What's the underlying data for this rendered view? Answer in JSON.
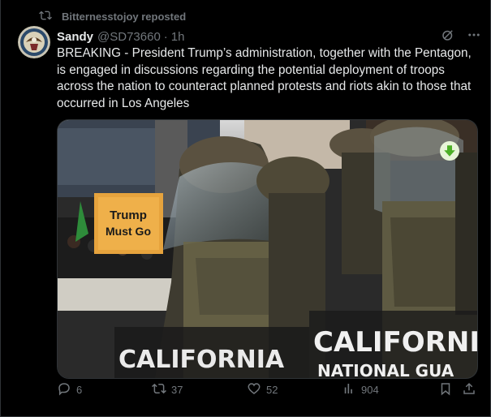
{
  "repost": {
    "text": "Bitternesstojoy reposted",
    "icon": "repost-icon"
  },
  "author": {
    "name": "Sandy",
    "handle": "@SD73660",
    "separator": "·",
    "time": "1h",
    "avatar": "eagle-seal-avatar"
  },
  "post_text": "BREAKING - President Trump’s administration, together with the Pentagon, is engaged in discussions regarding the potential deployment of troops across the nation to counteract planned protests and riots akin to those that occurred in Los Angeles",
  "media": {
    "sign_lines": [
      "Trump",
      "Must Go"
    ],
    "shield_text_left": "CALIFORNIA",
    "shield_text_right_1": "CALIFORNIA",
    "shield_text_right_2": "NATIONAL GUA",
    "download_icon": "download-arrow-icon"
  },
  "actions": {
    "replies": "6",
    "reposts": "37",
    "likes": "52",
    "views": "904"
  },
  "colors": {
    "background": "#000000",
    "text": "#e7e9ea",
    "muted": "#71767b",
    "border": "#2f3336",
    "download_green": "#4caf26"
  }
}
